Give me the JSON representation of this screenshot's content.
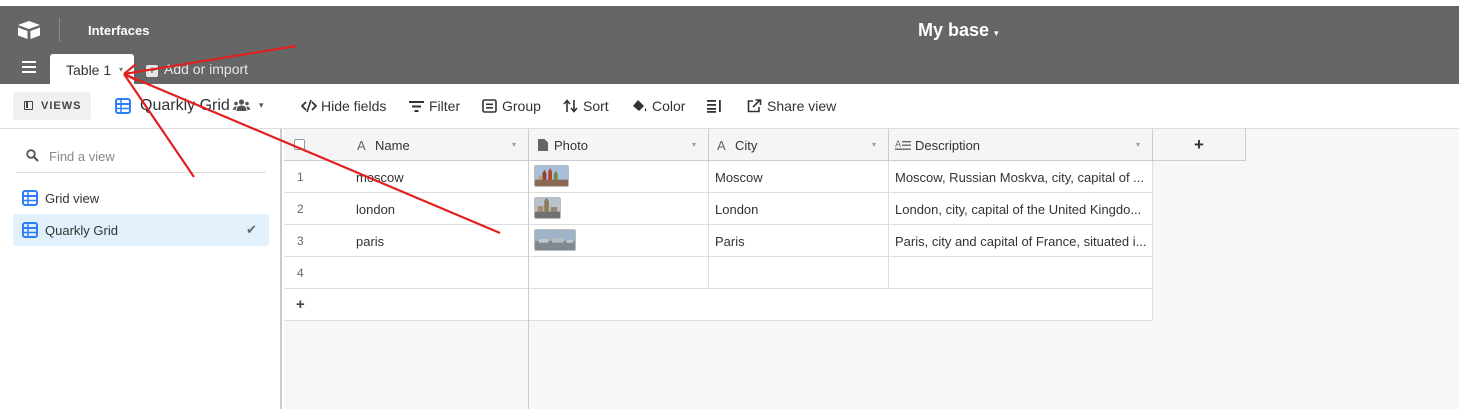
{
  "header": {
    "interfaces_label": "Interfaces",
    "base_title": "My base",
    "base_caret": "▾"
  },
  "tabs": {
    "active_tab_label": "Table 1",
    "active_tab_caret": "▾",
    "add_import_label": "Add or import",
    "add_import_plus": "+"
  },
  "toolbar": {
    "views_label": "VIEWS",
    "current_view": "Quarkly Grid",
    "view_caret": "▾",
    "hide_fields": "Hide fields",
    "filter": "Filter",
    "group": "Group",
    "sort": "Sort",
    "color": "Color",
    "share_view": "Share view"
  },
  "sidebar": {
    "find_placeholder": "Find a view",
    "views": [
      {
        "label": "Grid view",
        "active": false
      },
      {
        "label": "Quarkly Grid",
        "active": true,
        "check": "✔"
      }
    ]
  },
  "grid": {
    "columns": [
      {
        "label": "Name",
        "icon": "A"
      },
      {
        "label": "Photo",
        "icon": "attachment-icon"
      },
      {
        "label": "City",
        "icon": "A"
      },
      {
        "label": "Description",
        "icon": "long-text-icon"
      }
    ],
    "add_column": "+",
    "rows": [
      {
        "num": "1",
        "name": "moscow",
        "city": "Moscow",
        "description": "Moscow, Russian Moskva, city, capital of ..."
      },
      {
        "num": "2",
        "name": "london",
        "city": "London",
        "description": "London, city, capital of the United Kingdo..."
      },
      {
        "num": "3",
        "name": "paris",
        "city": "Paris",
        "description": "Paris, city and capital of France, situated i..."
      },
      {
        "num": "4",
        "name": "",
        "city": "",
        "description": ""
      }
    ],
    "add_row": "+"
  },
  "colors": {
    "header_bg": "#666666",
    "accent_blue": "#2d7ff9",
    "selected_view_bg": "#e1f0fa",
    "annotation_red": "#e02020"
  }
}
